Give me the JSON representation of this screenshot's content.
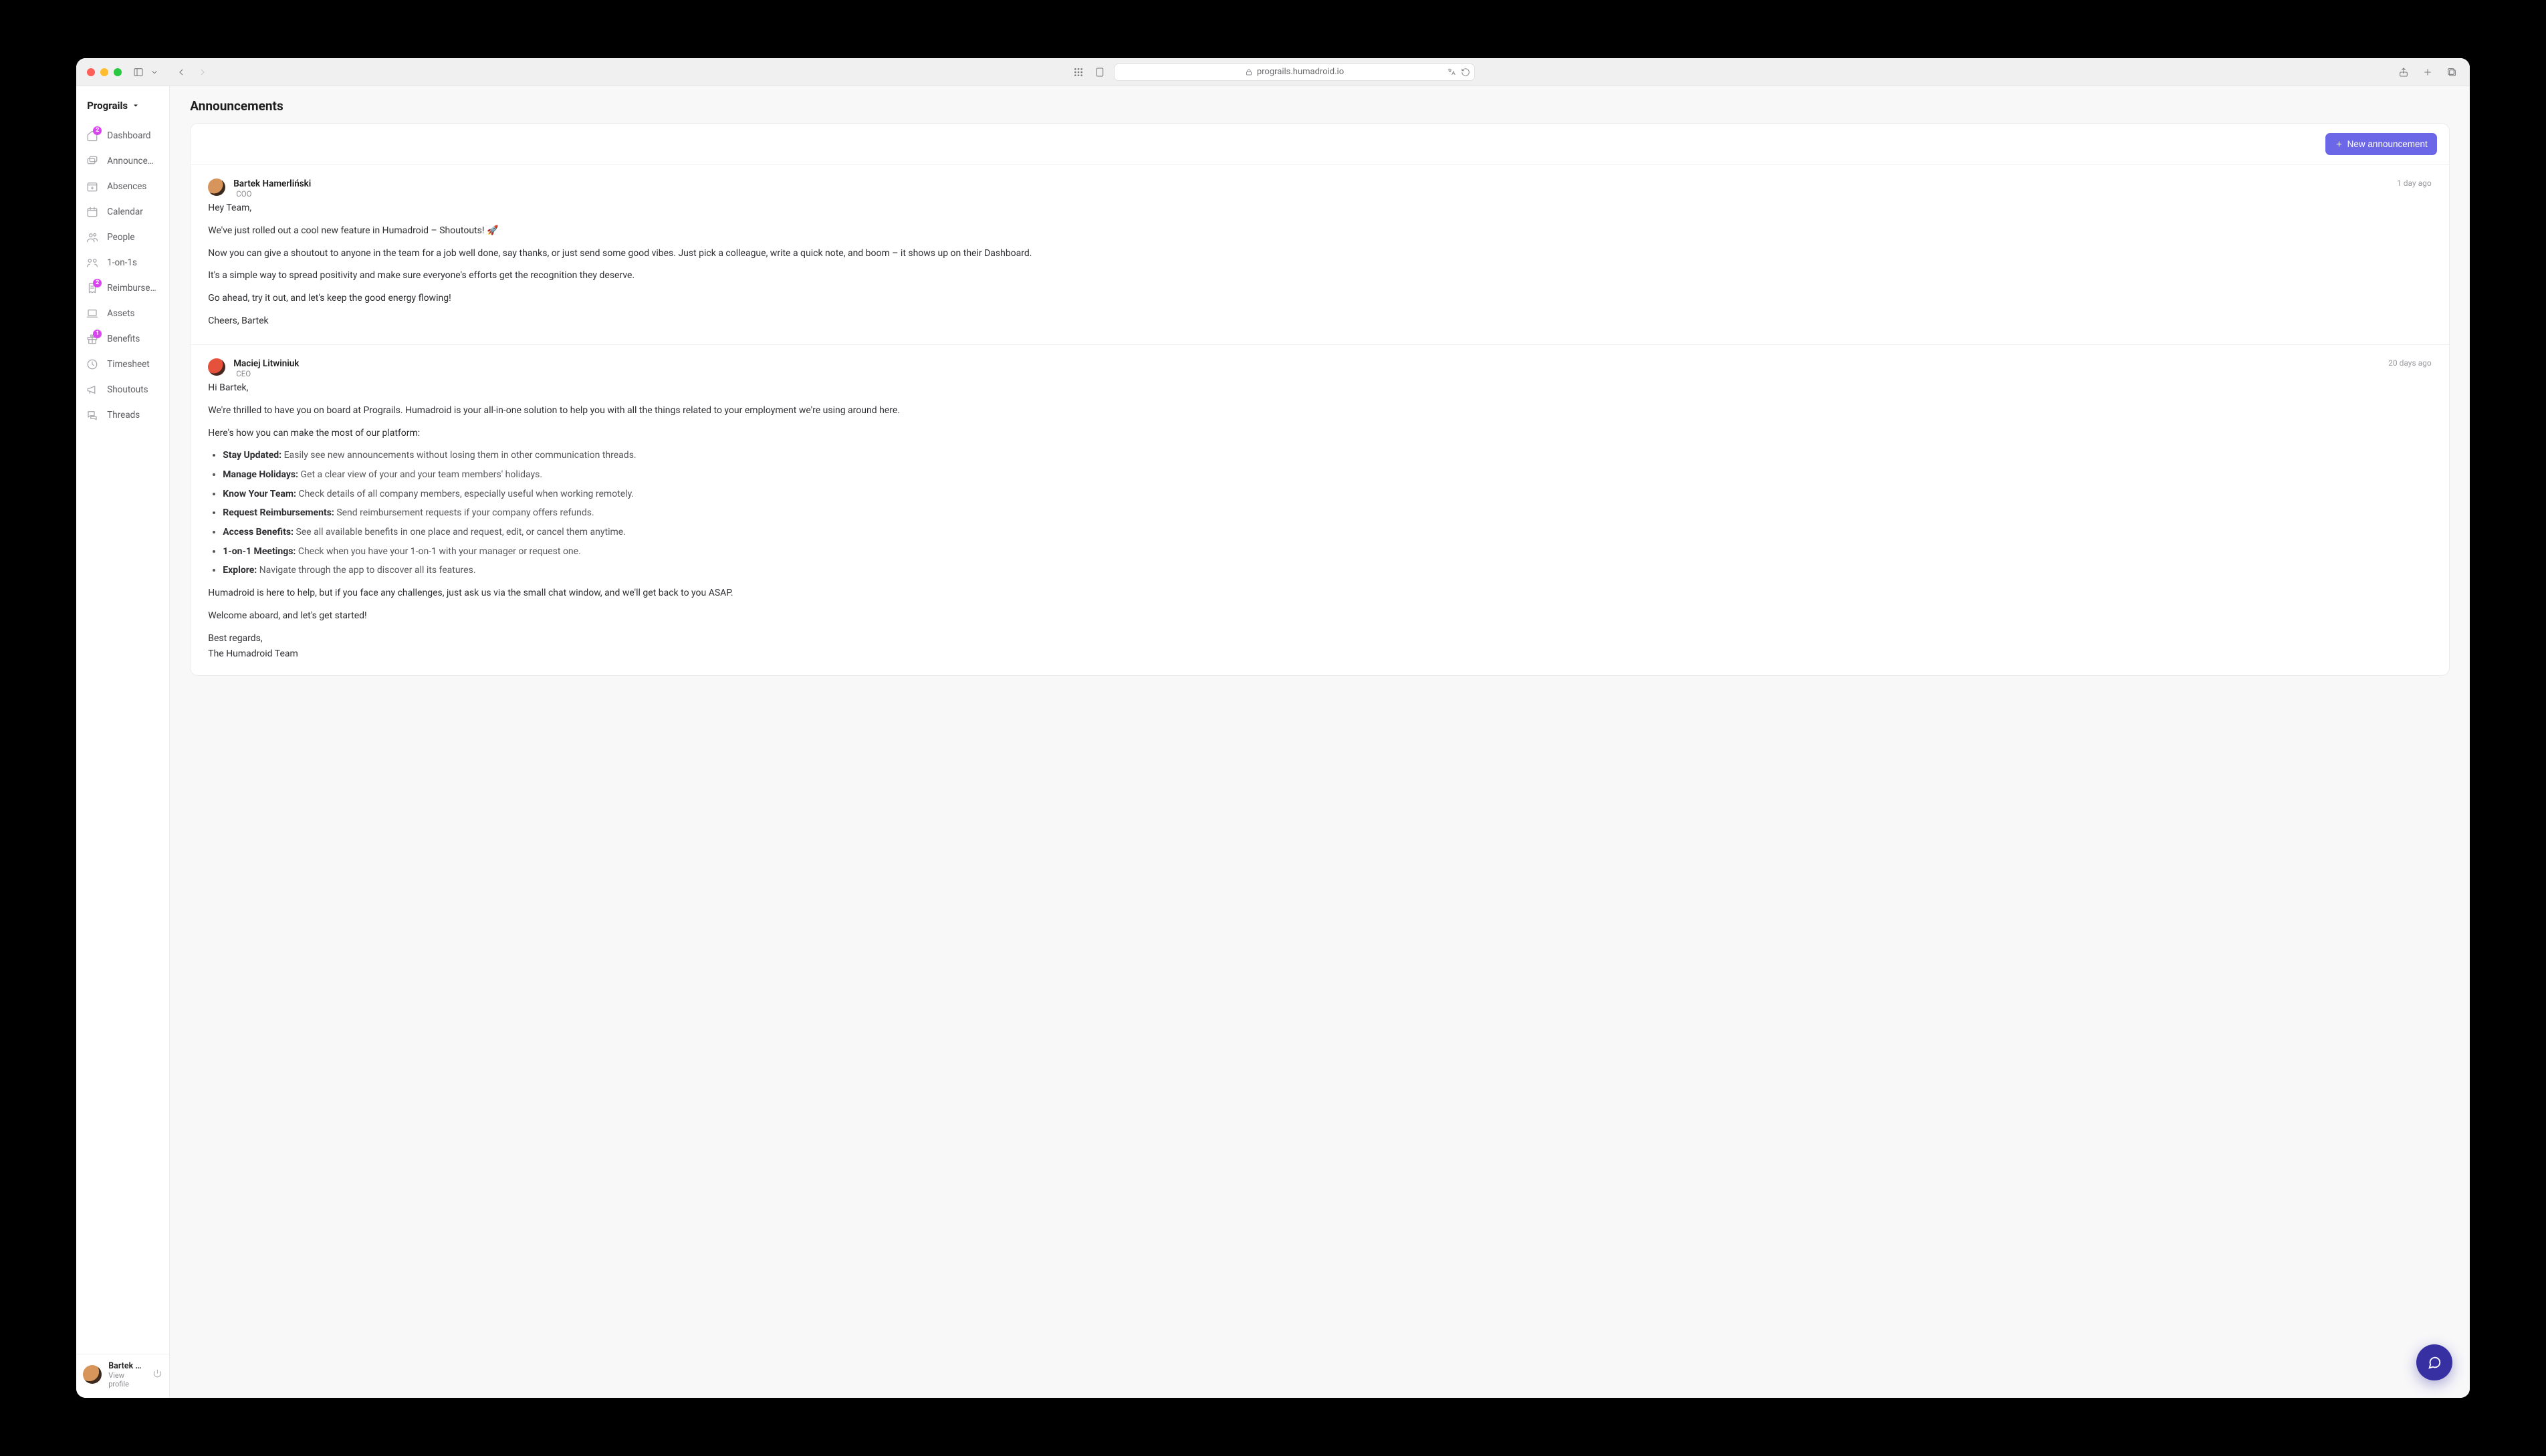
{
  "browser": {
    "url": "prograils.humadroid.io"
  },
  "sidebar": {
    "workspace": "Prograils",
    "items": [
      {
        "label": "Dashboard",
        "badge": "2"
      },
      {
        "label": "Announcements",
        "badge": null
      },
      {
        "label": "Absences",
        "badge": null
      },
      {
        "label": "Calendar",
        "badge": null
      },
      {
        "label": "People",
        "badge": null
      },
      {
        "label": "1-on-1s",
        "badge": null
      },
      {
        "label": "Reimbursements",
        "badge": "2"
      },
      {
        "label": "Assets",
        "badge": null
      },
      {
        "label": "Benefits",
        "badge": "1"
      },
      {
        "label": "Timesheet",
        "badge": null
      },
      {
        "label": "Shoutouts",
        "badge": null
      },
      {
        "label": "Threads",
        "badge": null
      }
    ],
    "footer": {
      "name": "Bartek Hamerli",
      "sub": "View profile"
    }
  },
  "page": {
    "title": "Announcements",
    "new_button": "New announcement"
  },
  "posts": [
    {
      "author": "Bartek Hamerliński",
      "role": "COO",
      "time": "1 day ago",
      "paragraphs": [
        "Hey Team,",
        "We've just rolled out a cool new feature in Humadroid – Shoutouts! 🚀",
        "Now you can give a shoutout to anyone in the team for a job well done, say thanks, or just send some good vibes. Just pick a colleague, write a quick note, and boom – it shows up on their Dashboard.",
        "It's a simple way to spread positivity and make sure everyone's efforts get the recognition they deserve.",
        "Go ahead, try it out, and let's keep the good energy flowing!",
        "Cheers, Bartek"
      ]
    },
    {
      "author": "Maciej Litwiniuk",
      "role": "CEO",
      "time": "20 days ago",
      "intro": [
        "Hi Bartek,",
        "We're thrilled to have you on board at Prograils. Humadroid is your all-in-one solution to help you with all the things related to your employment we're using around here.",
        "Here's how you can make the most of our platform:"
      ],
      "bullets": [
        {
          "b": "Stay Updated:",
          "t": " Easily see new announcements without losing them in other communication threads."
        },
        {
          "b": "Manage Holidays:",
          "t": " Get a clear view of your and your team members' holidays."
        },
        {
          "b": "Know Your Team:",
          "t": " Check details of all company members, especially useful when working remotely."
        },
        {
          "b": "Request Reimbursements:",
          "t": " Send reimbursement requests if your company offers refunds."
        },
        {
          "b": "Access Benefits:",
          "t": " See all available benefits in one place and request, edit, or cancel them anytime."
        },
        {
          "b": "1-on-1 Meetings:",
          "t": " Check when you have your 1-on-1 with your manager or request one."
        },
        {
          "b": "Explore:",
          "t": " Navigate through the app to discover all its features."
        }
      ],
      "outro": [
        "Humadroid is here to help, but if you face any challenges, just ask us via the small chat window, and we'll get back to you ASAP.",
        "Welcome aboard, and let's get started!",
        "Best regards,",
        "The Humadroid Team"
      ]
    }
  ]
}
